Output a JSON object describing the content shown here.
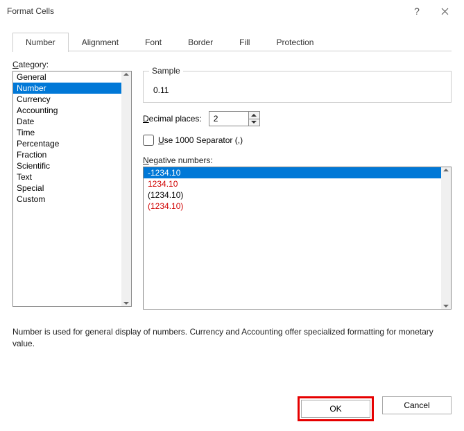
{
  "window": {
    "title": "Format Cells"
  },
  "tabs": {
    "items": [
      "Number",
      "Alignment",
      "Font",
      "Border",
      "Fill",
      "Protection"
    ],
    "active": "Number"
  },
  "category": {
    "label": "Category:",
    "items": [
      "General",
      "Number",
      "Currency",
      "Accounting",
      "Date",
      "Time",
      "Percentage",
      "Fraction",
      "Scientific",
      "Text",
      "Special",
      "Custom"
    ],
    "selected": "Number"
  },
  "sample": {
    "legend": "Sample",
    "value": "0.11"
  },
  "decimal": {
    "label_pre": "D",
    "label_rest": "ecimal places:",
    "value": "2"
  },
  "separator": {
    "label_pre": "U",
    "label_rest": "se 1000 Separator (,)",
    "checked": false
  },
  "negative": {
    "label_pre": "N",
    "label_rest": "egative numbers:",
    "items": [
      {
        "text": "-1234.10",
        "red": false,
        "selected": true
      },
      {
        "text": "1234.10",
        "red": true,
        "selected": false
      },
      {
        "text": "(1234.10)",
        "red": false,
        "selected": false
      },
      {
        "text": "(1234.10)",
        "red": true,
        "selected": false
      }
    ]
  },
  "description": "Number is used for general display of numbers.  Currency and Accounting offer specialized formatting for monetary value.",
  "buttons": {
    "ok": "OK",
    "cancel": "Cancel"
  }
}
